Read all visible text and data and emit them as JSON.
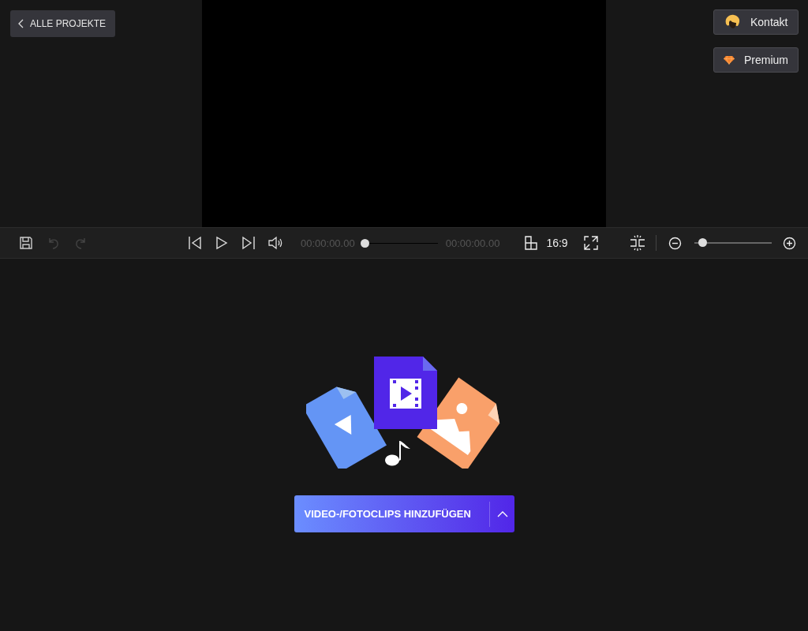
{
  "back_button": {
    "label": "ALLE PROJEKTE"
  },
  "top_buttons": [
    {
      "kind": "contact",
      "label": "Kontakt"
    },
    {
      "kind": "premium",
      "label": "Premium"
    }
  ],
  "toolbar": {
    "undo": {
      "disabled": true
    },
    "redo": {
      "disabled": true
    },
    "current_time": "00:00:00.00",
    "seek": {
      "level": 0
    },
    "total_time": "00:00:00.00",
    "aspect_ratio": "16:9",
    "zoom": {
      "level": 0.06
    }
  },
  "add_button": {
    "label": "VIDEO-/FOTOCLIPS HINZUFÜGEN"
  }
}
